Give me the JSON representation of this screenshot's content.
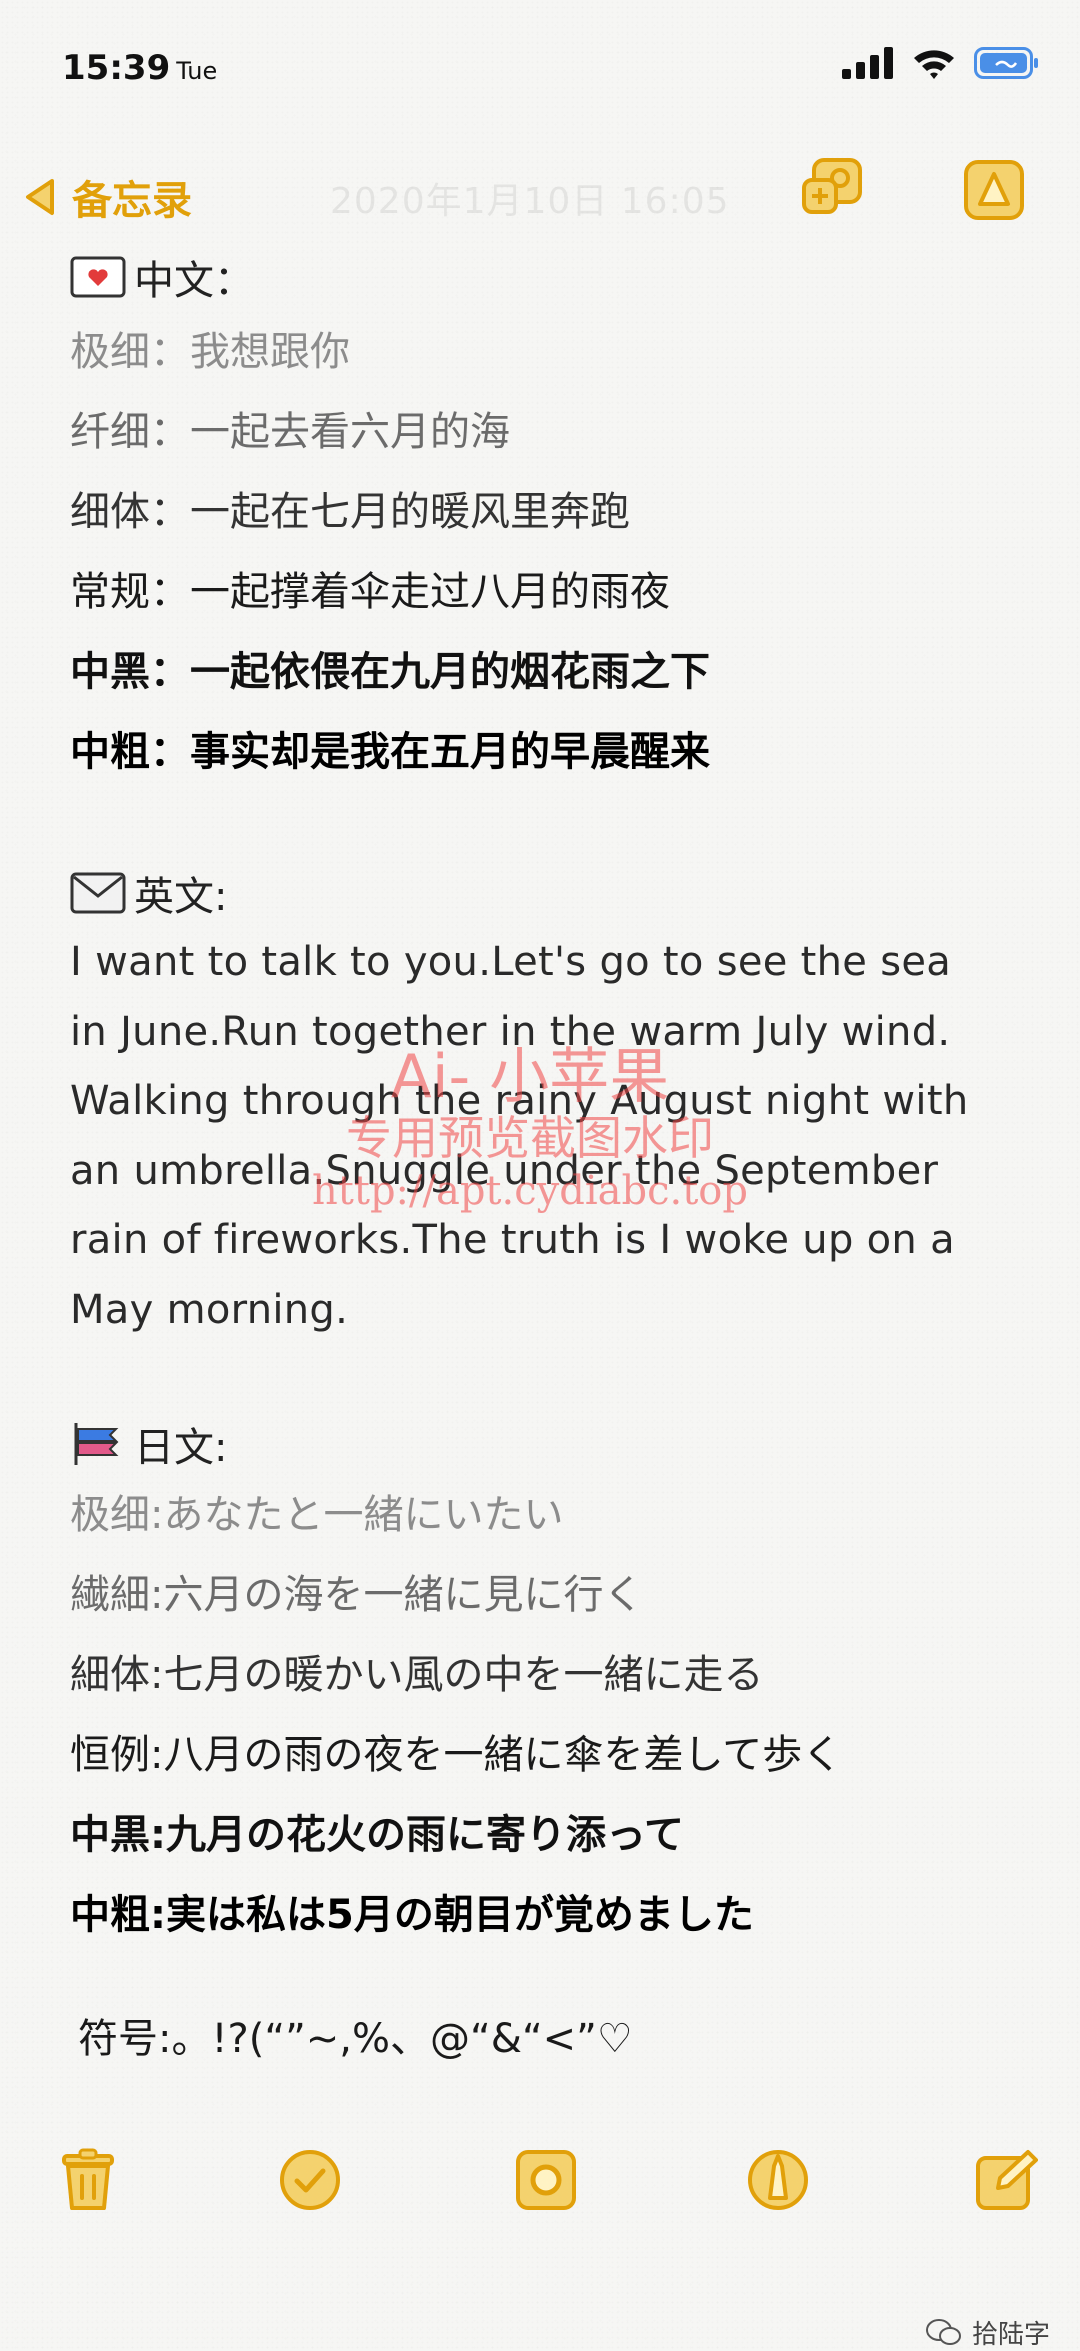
{
  "status_bar": {
    "time": "15:39",
    "day": "Tue"
  },
  "nav": {
    "back_label": "备忘录",
    "faint_date": "2020年1月10日 16:05"
  },
  "sections": {
    "chinese": {
      "heading": "中文：",
      "lines": [
        "极细：我想跟你",
        "纤细：一起去看六月的海",
        "细体：一起在七月的暖风里奔跑",
        "常规：一起撑着伞走过八月的雨夜",
        "中黑：一起依偎在九月的烟花雨之下",
        "中粗：事实却是我在五月的早晨醒来"
      ]
    },
    "english": {
      "heading": "英文:",
      "lines": [
        "I want to talk to you.Let's go to see the sea",
        "in June.Run together in the warm July wind.",
        "Walking through the rainy August night with",
        "an umbrella.Snuggle under the September",
        "rain of fireworks.The truth is I woke up on a",
        "May morning."
      ]
    },
    "japanese": {
      "heading": "日文:",
      "lines": [
        "极细:あなたと一緒にいたい",
        "繊細:六月の海を一緒に見に行く",
        "細体:七月の暖かい風の中を一緒に走る",
        "恒例:八月の雨の夜を一緒に傘を差して歩く",
        "中黒:九月の花火の雨に寄り添って",
        "中粗:実は私は5月の朝目が覚めました"
      ]
    },
    "symbols": "符号:。!?(“”~,%、@“&“<”♡"
  },
  "watermark": {
    "line1": "Ai- 小苹果",
    "line2": "专用预览截图水印",
    "line3": "http://apt.cydiabc.top"
  },
  "footer": {
    "wechat_label": "拾陆字"
  },
  "colors": {
    "accent": "#e1a00a",
    "icon_fill": "#f4d26e"
  }
}
